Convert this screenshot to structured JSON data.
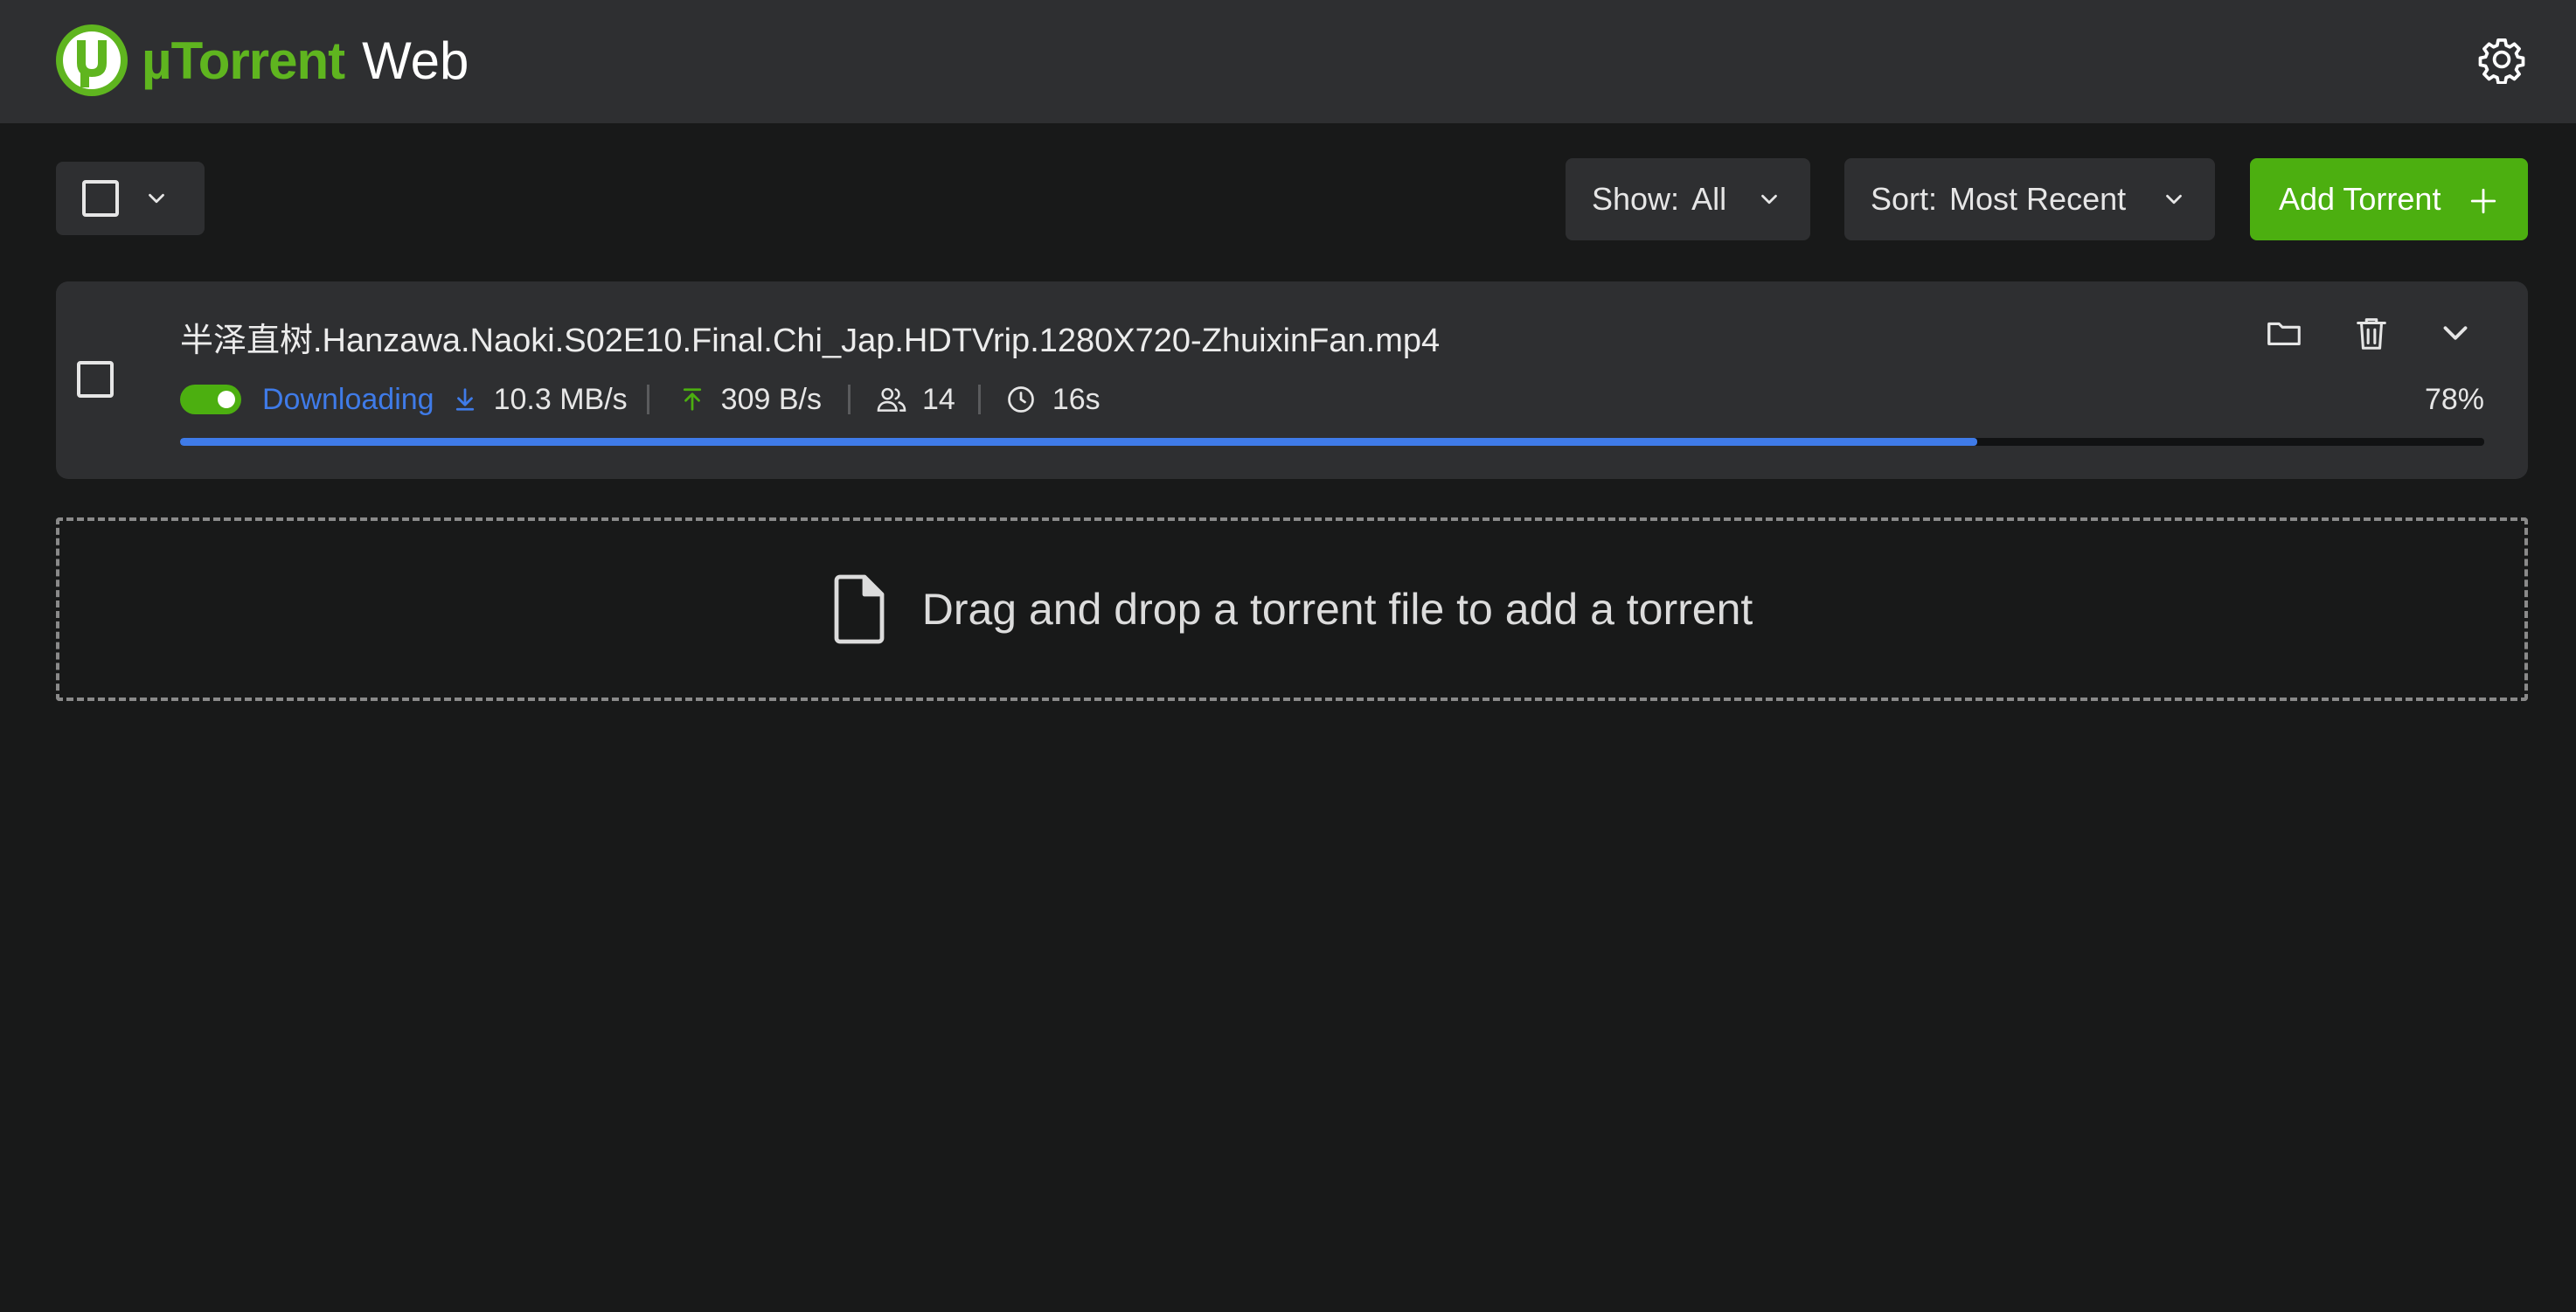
{
  "header": {
    "logo_text": "µTorrent",
    "logo_web": "Web",
    "settings_icon": "gear-icon"
  },
  "toolbar": {
    "show_label": "Show:",
    "show_value": "All",
    "sort_label": "Sort:",
    "sort_value": "Most Recent",
    "add_torrent_label": "Add Torrent"
  },
  "torrents": [
    {
      "name": "半泽直树.Hanzawa.Naoki.S02E10.Final.Chi_Jap.HDTVrip.1280X720-ZhuixinFan.mp4",
      "status": "Downloading",
      "enabled": true,
      "download_speed": "10.3 MB/s",
      "upload_speed": "309 B/s",
      "peers": "14",
      "eta": "16s",
      "percent": "78%",
      "progress": 0.78
    }
  ],
  "dropzone": {
    "text": "Drag and drop a torrent file to add a torrent"
  },
  "colors": {
    "brand_green": "#4caf10",
    "status_blue": "#3f7be8",
    "background": "#181919",
    "panel": "#2e2f31"
  }
}
